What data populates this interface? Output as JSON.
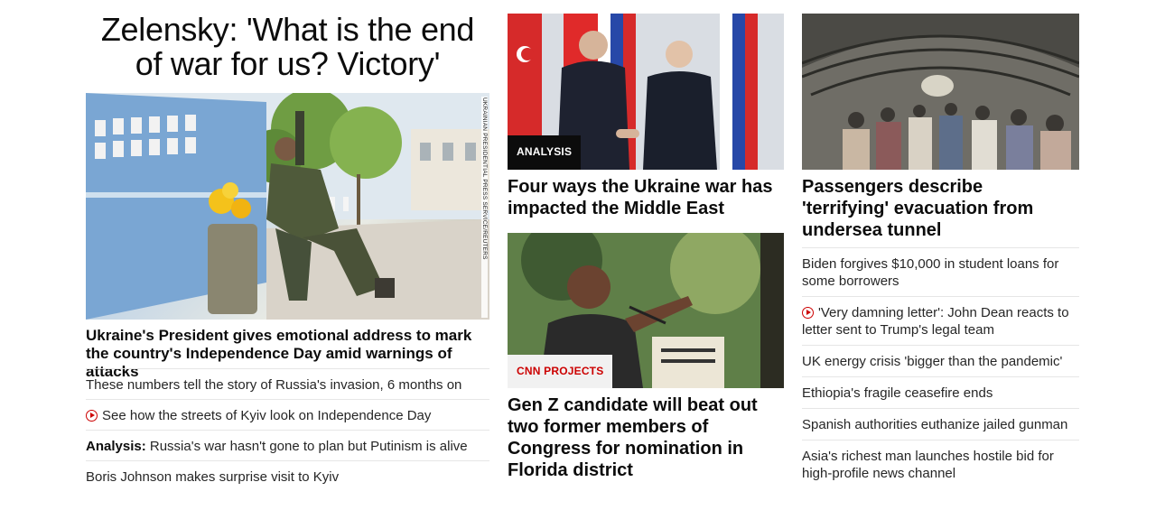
{
  "col1": {
    "headline": "Zelensky: 'What is the end of war for us? Victory'",
    "image_credit": "UKRAINIAN PRESIDENTIAL PRESS SERVICE/REUTERS",
    "caption": "Ukraine's President gives emotional address to mark the country's Independence Day amid warnings of attacks",
    "links": [
      {
        "text": "These numbers tell the story of Russia's invasion, 6 months on",
        "prefix": "",
        "video": false
      },
      {
        "text": "See how the streets of Kyiv look on Independence Day",
        "prefix": "",
        "video": true
      },
      {
        "text": "Russia's war hasn't gone to plan but Putinism is alive",
        "prefix": "Analysis:",
        "video": false
      },
      {
        "text": "Boris Johnson makes surprise visit to Kyiv",
        "prefix": "",
        "video": false
      }
    ]
  },
  "col2": {
    "story1": {
      "badge": "ANALYSIS",
      "headline": "Four ways the Ukraine war has impacted the Middle East"
    },
    "story2": {
      "badge": "CNN PROJECTS",
      "headline": "Gen Z candidate will beat out two former members of Congress for nomination in Florida district"
    }
  },
  "col3": {
    "story": {
      "headline": "Passengers describe 'terrifying' evacuation from undersea tunnel"
    },
    "links": [
      {
        "text": "Biden forgives $10,000 in student loans for some borrowers",
        "video": false
      },
      {
        "text": "'Very damning letter': John Dean reacts to letter sent to Trump's legal team",
        "video": true
      },
      {
        "text": "UK energy crisis 'bigger than the pandemic'",
        "video": false
      },
      {
        "text": "Ethiopia's fragile ceasefire ends",
        "video": false
      },
      {
        "text": "Spanish authorities euthanize jailed gunman",
        "video": false
      },
      {
        "text": "Asia's richest man launches hostile bid for high-profile news channel",
        "video": false
      }
    ]
  },
  "colors": {
    "accent_red": "#cc0000",
    "text": "#0c0c0c",
    "divider": "#e6e6e6"
  }
}
